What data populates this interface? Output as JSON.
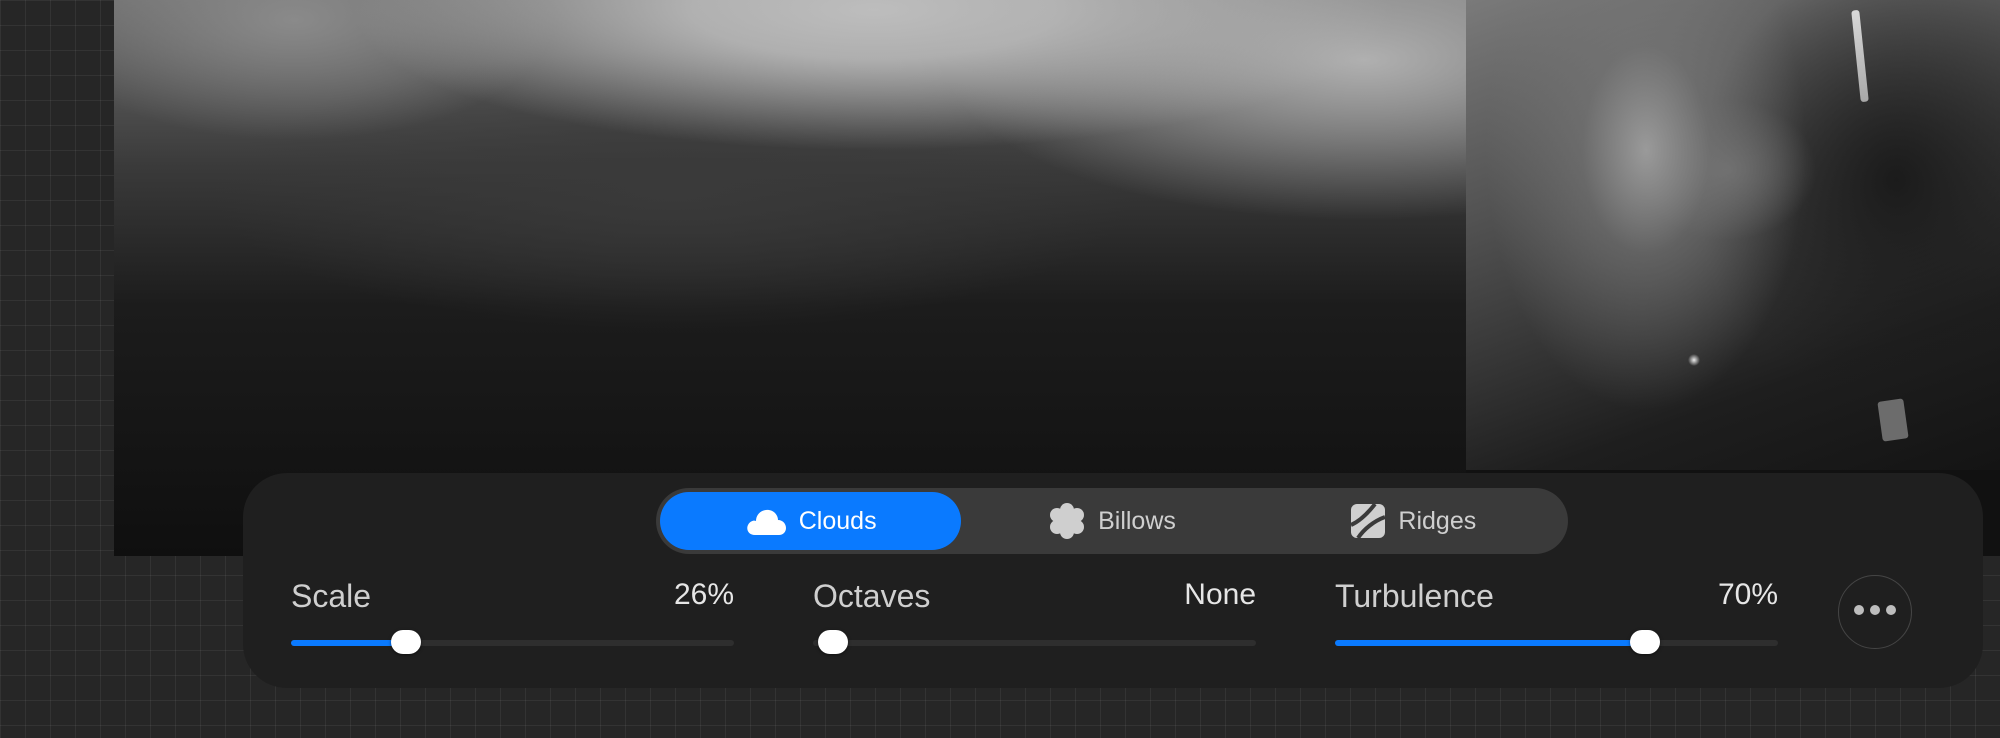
{
  "canvas": {
    "description": "blurred noise image with photo"
  },
  "noise_tabs": [
    {
      "label": "Clouds",
      "icon": "cloud-icon",
      "active": true
    },
    {
      "label": "Billows",
      "icon": "billows-icon",
      "active": false
    },
    {
      "label": "Ridges",
      "icon": "ridges-icon",
      "active": false
    }
  ],
  "sliders": {
    "scale": {
      "label": "Scale",
      "value_text": "26%",
      "value": 0.26
    },
    "octaves": {
      "label": "Octaves",
      "value_text": "None",
      "value": 0.0
    },
    "turbulence": {
      "label": "Turbulence",
      "value_text": "70%",
      "value": 0.7
    }
  },
  "more_button": {
    "icon": "more-icon"
  },
  "colors": {
    "accent": "#0a7aff",
    "panel": "#1f1f1f",
    "segment_bg": "#3a3a3a",
    "workspace_bg": "#262626"
  }
}
